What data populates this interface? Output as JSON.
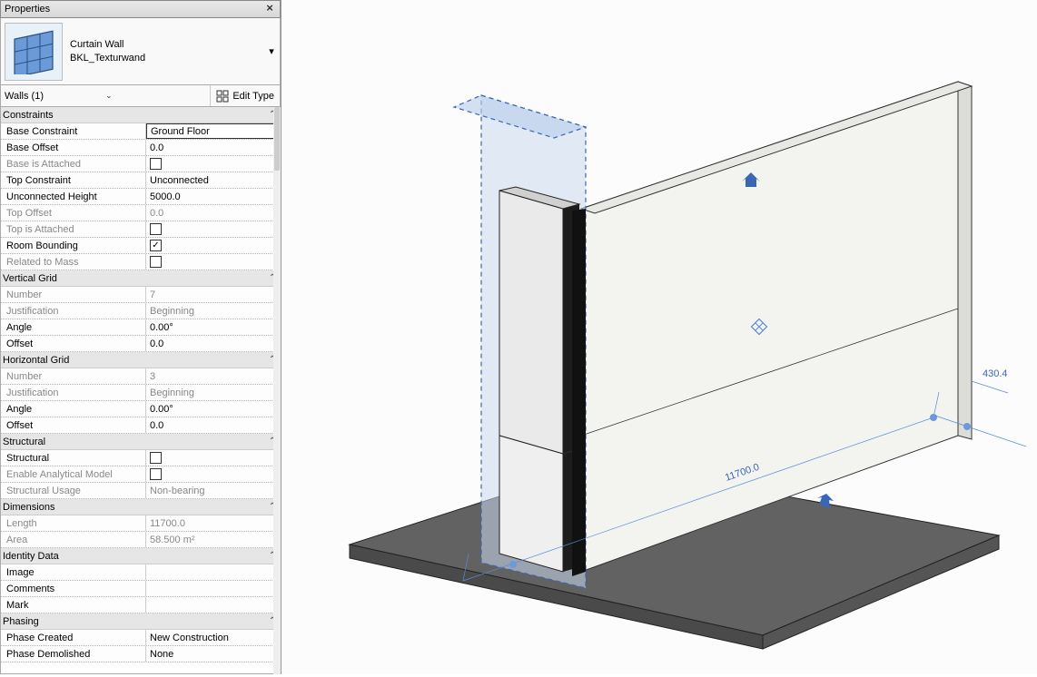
{
  "panel": {
    "title": "Properties",
    "type_family": "Curtain Wall",
    "type_name": "BKL_Texturwand",
    "selector_label": "Walls (1)",
    "edit_type_label": "Edit Type"
  },
  "groups": [
    {
      "name": "Constraints",
      "rows": [
        {
          "label": "Base Constraint",
          "value": "Ground Floor",
          "kind": "text",
          "selected": true
        },
        {
          "label": "Base Offset",
          "value": "0.0",
          "kind": "text"
        },
        {
          "label": "Base is Attached",
          "value": "",
          "kind": "check",
          "checked": false,
          "dim": true
        },
        {
          "label": "Top Constraint",
          "value": "Unconnected",
          "kind": "text"
        },
        {
          "label": "Unconnected Height",
          "value": "5000.0",
          "kind": "text"
        },
        {
          "label": "Top Offset",
          "value": "0.0",
          "kind": "text",
          "dim": true
        },
        {
          "label": "Top is Attached",
          "value": "",
          "kind": "check",
          "checked": false,
          "dim": true
        },
        {
          "label": "Room Bounding",
          "value": "",
          "kind": "check",
          "checked": true
        },
        {
          "label": "Related to Mass",
          "value": "",
          "kind": "check",
          "checked": false,
          "dim": true
        }
      ]
    },
    {
      "name": "Vertical Grid",
      "rows": [
        {
          "label": "Number",
          "value": "7",
          "kind": "text",
          "dim": true
        },
        {
          "label": "Justification",
          "value": "Beginning",
          "kind": "text",
          "dim": true
        },
        {
          "label": "Angle",
          "value": "0.00°",
          "kind": "text"
        },
        {
          "label": "Offset",
          "value": "0.0",
          "kind": "text"
        }
      ]
    },
    {
      "name": "Horizontal Grid",
      "rows": [
        {
          "label": "Number",
          "value": "3",
          "kind": "text",
          "dim": true
        },
        {
          "label": "Justification",
          "value": "Beginning",
          "kind": "text",
          "dim": true
        },
        {
          "label": "Angle",
          "value": "0.00°",
          "kind": "text"
        },
        {
          "label": "Offset",
          "value": "0.0",
          "kind": "text"
        }
      ]
    },
    {
      "name": "Structural",
      "rows": [
        {
          "label": "Structural",
          "value": "",
          "kind": "check",
          "checked": false
        },
        {
          "label": "Enable Analytical Model",
          "value": "",
          "kind": "check",
          "checked": false,
          "dim": true
        },
        {
          "label": "Structural Usage",
          "value": "Non-bearing",
          "kind": "text",
          "dim": true
        }
      ]
    },
    {
      "name": "Dimensions",
      "rows": [
        {
          "label": "Length",
          "value": "11700.0",
          "kind": "text",
          "dim": true
        },
        {
          "label": "Area",
          "value": "58.500 m²",
          "kind": "text",
          "dim": true
        }
      ]
    },
    {
      "name": "Identity Data",
      "rows": [
        {
          "label": "Image",
          "value": "",
          "kind": "text"
        },
        {
          "label": "Comments",
          "value": "",
          "kind": "text"
        },
        {
          "label": "Mark",
          "value": "",
          "kind": "text"
        }
      ]
    },
    {
      "name": "Phasing",
      "rows": [
        {
          "label": "Phase Created",
          "value": "New Construction",
          "kind": "text"
        },
        {
          "label": "Phase Demolished",
          "value": "None",
          "kind": "text"
        }
      ]
    }
  ],
  "viewport": {
    "dim_main": "11700.0",
    "dim_side": "430.4"
  }
}
